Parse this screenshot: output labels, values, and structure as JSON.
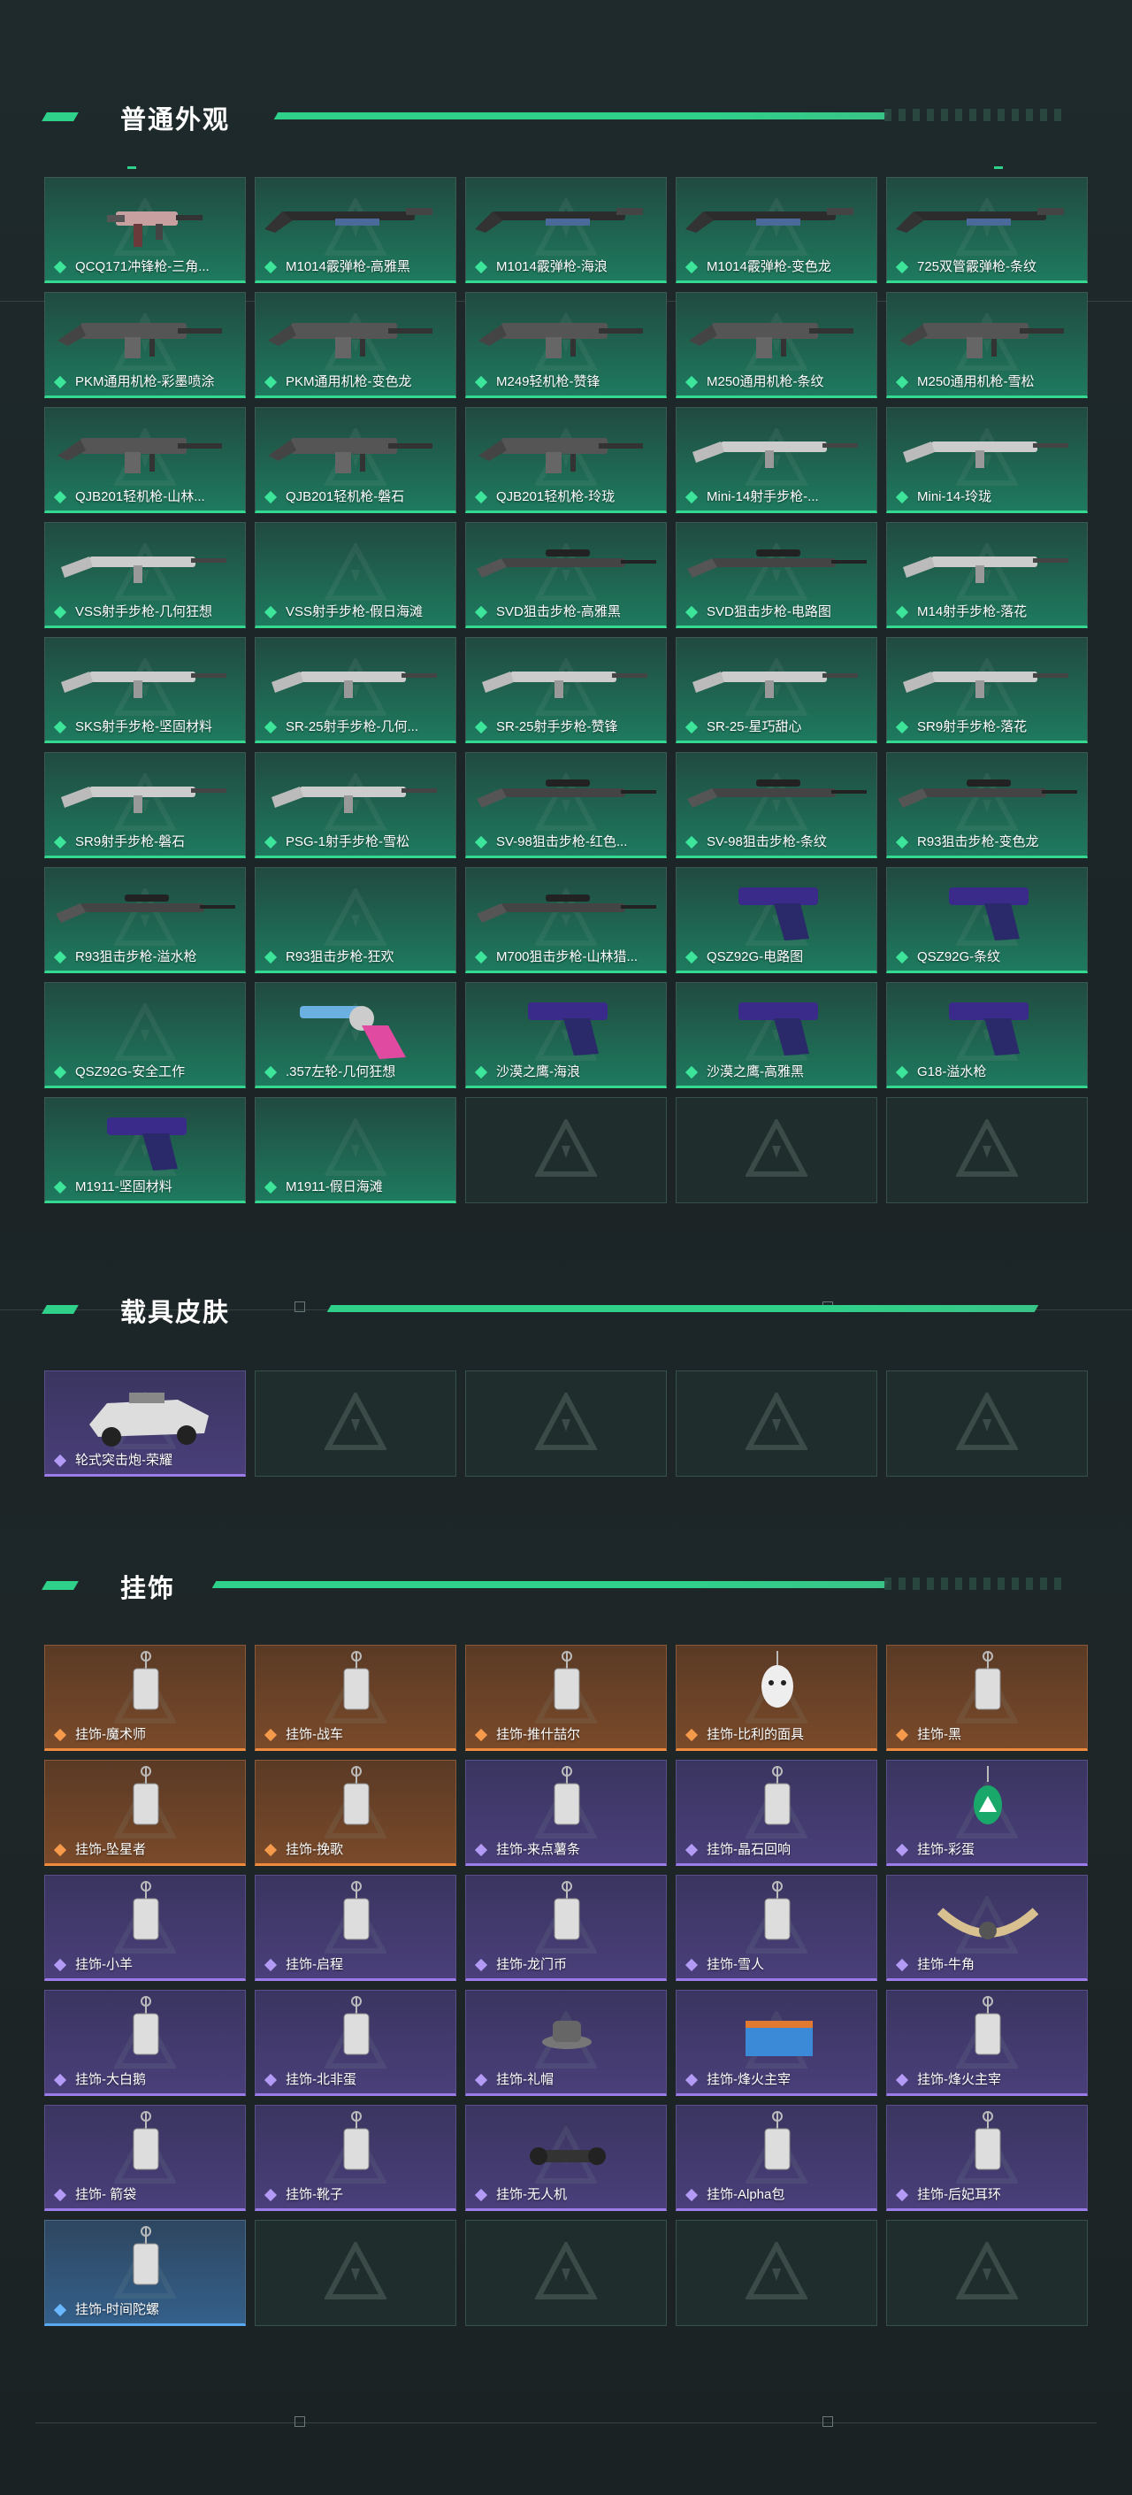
{
  "sections": {
    "weapons": {
      "title": "普通外观",
      "items": [
        {
          "label": "QCQ171冲锋枪-三角...",
          "rarity": "green",
          "icon": "smg-icon"
        },
        {
          "label": "M1014霰弹枪-高雅黑",
          "rarity": "green",
          "icon": "shotgun-icon"
        },
        {
          "label": "M1014霰弹枪-海浪",
          "rarity": "green",
          "icon": "shotgun-icon"
        },
        {
          "label": "M1014霰弹枪-变色龙",
          "rarity": "green",
          "icon": "shotgun-icon"
        },
        {
          "label": "725双管霰弹枪-条纹",
          "rarity": "green",
          "icon": "shotgun-icon"
        },
        {
          "label": "PKM通用机枪-彩墨喷涂",
          "rarity": "green",
          "icon": "machinegun-icon"
        },
        {
          "label": "PKM通用机枪-变色龙",
          "rarity": "green",
          "icon": "machinegun-icon"
        },
        {
          "label": "M249轻机枪-赞锋",
          "rarity": "green",
          "icon": "machinegun-icon"
        },
        {
          "label": "M250通用机枪-条纹",
          "rarity": "green",
          "icon": "machinegun-icon"
        },
        {
          "label": "M250通用机枪-雪松",
          "rarity": "green",
          "icon": "machinegun-icon"
        },
        {
          "label": "QJB201轻机枪-山林...",
          "rarity": "green",
          "icon": "machinegun-icon"
        },
        {
          "label": "QJB201轻机枪-磐石",
          "rarity": "green",
          "icon": "machinegun-icon"
        },
        {
          "label": "QJB201轻机枪-玲珑",
          "rarity": "green",
          "icon": "machinegun-icon"
        },
        {
          "label": "Mini-14射手步枪-...",
          "rarity": "green",
          "icon": "rifle-icon"
        },
        {
          "label": "Mini-14-玲珑",
          "rarity": "green",
          "icon": "rifle-icon"
        },
        {
          "label": "VSS射手步枪-几何狂想",
          "rarity": "green",
          "icon": "rifle-icon"
        },
        {
          "label": "VSS射手步枪-假日海滩",
          "rarity": "green",
          "icon": ""
        },
        {
          "label": "SVD狙击步枪-高雅黑",
          "rarity": "green",
          "icon": "sniper-icon"
        },
        {
          "label": "SVD狙击步枪-电路图",
          "rarity": "green",
          "icon": "sniper-icon"
        },
        {
          "label": "M14射手步枪-落花",
          "rarity": "green",
          "icon": "rifle-icon"
        },
        {
          "label": "SKS射手步枪-坚固材料",
          "rarity": "green",
          "icon": "rifle-icon"
        },
        {
          "label": "SR-25射手步枪-几何...",
          "rarity": "green",
          "icon": "rifle-icon"
        },
        {
          "label": "SR-25射手步枪-赞锋",
          "rarity": "green",
          "icon": "rifle-icon"
        },
        {
          "label": "SR-25-星巧甜心",
          "rarity": "green",
          "icon": "rifle-icon"
        },
        {
          "label": "SR9射手步枪-落花",
          "rarity": "green",
          "icon": "rifle-icon"
        },
        {
          "label": "SR9射手步枪-磐石",
          "rarity": "green",
          "icon": "rifle-icon"
        },
        {
          "label": "PSG-1射手步枪-雪松",
          "rarity": "green",
          "icon": "rifle-icon"
        },
        {
          "label": "SV-98狙击步枪-红色...",
          "rarity": "green",
          "icon": "sniper-icon"
        },
        {
          "label": "SV-98狙击步枪-条纹",
          "rarity": "green",
          "icon": "sniper-icon"
        },
        {
          "label": "R93狙击步枪-变色龙",
          "rarity": "green",
          "icon": "sniper-icon"
        },
        {
          "label": "R93狙击步枪-溢水枪",
          "rarity": "green",
          "icon": "sniper-icon"
        },
        {
          "label": "R93狙击步枪-狂欢",
          "rarity": "green",
          "icon": ""
        },
        {
          "label": "M700狙击步枪-山林猎...",
          "rarity": "green",
          "icon": "sniper-icon"
        },
        {
          "label": "QSZ92G-电路图",
          "rarity": "green",
          "icon": "pistol-icon"
        },
        {
          "label": "QSZ92G-条纹",
          "rarity": "green",
          "icon": "pistol-icon"
        },
        {
          "label": "QSZ92G-安全工作",
          "rarity": "green",
          "icon": ""
        },
        {
          "label": ".357左轮-几何狂想",
          "rarity": "green",
          "icon": "revolver-icon"
        },
        {
          "label": "沙漠之鹰-海浪",
          "rarity": "green",
          "icon": "pistol-icon"
        },
        {
          "label": "沙漠之鹰-高雅黑",
          "rarity": "green",
          "icon": "pistol-icon"
        },
        {
          "label": "G18-溢水枪",
          "rarity": "green",
          "icon": "pistol-icon"
        },
        {
          "label": "M1911-坚固材料",
          "rarity": "green",
          "icon": "pistol-icon"
        },
        {
          "label": "M1911-假日海滩",
          "rarity": "green",
          "icon": ""
        },
        {
          "label": "",
          "rarity": "empty",
          "icon": ""
        },
        {
          "label": "",
          "rarity": "empty",
          "icon": ""
        },
        {
          "label": "",
          "rarity": "empty",
          "icon": ""
        }
      ]
    },
    "vehicles": {
      "title": "载具皮肤",
      "items": [
        {
          "label": "轮式突击炮-荣耀",
          "rarity": "purple",
          "icon": "vehicle-icon"
        },
        {
          "label": "",
          "rarity": "empty",
          "icon": ""
        },
        {
          "label": "",
          "rarity": "empty",
          "icon": ""
        },
        {
          "label": "",
          "rarity": "empty",
          "icon": ""
        },
        {
          "label": "",
          "rarity": "empty",
          "icon": ""
        }
      ]
    },
    "charms": {
      "title": "挂饰",
      "items": [
        {
          "label": "挂饰-魔术师",
          "rarity": "orange",
          "icon": "charm-tag-icon"
        },
        {
          "label": "挂饰-战车",
          "rarity": "orange",
          "icon": "charm-card-icon"
        },
        {
          "label": "挂饰-推什喆尔",
          "rarity": "orange",
          "icon": "charm-tag-icon"
        },
        {
          "label": "挂饰-比利的面具",
          "rarity": "orange",
          "icon": "charm-mask-icon"
        },
        {
          "label": "挂饰-黑",
          "rarity": "orange",
          "icon": "charm-tag-icon"
        },
        {
          "label": "挂饰-坠星者",
          "rarity": "orange",
          "icon": "charm-crystal-icon"
        },
        {
          "label": "挂饰-挽歌",
          "rarity": "orange",
          "icon": "charm-leaf-icon"
        },
        {
          "label": "挂饰-来点薯条",
          "rarity": "purple",
          "icon": "charm-fries-icon"
        },
        {
          "label": "挂饰-晶石回响",
          "rarity": "purple",
          "icon": "charm-gem-icon"
        },
        {
          "label": "挂饰-彩蛋",
          "rarity": "purple",
          "icon": "charm-egg-icon"
        },
        {
          "label": "挂饰-小羊",
          "rarity": "purple",
          "icon": "charm-sheep-icon"
        },
        {
          "label": "挂饰-启程",
          "rarity": "purple",
          "icon": "charm-medal-icon"
        },
        {
          "label": "挂饰-龙门币",
          "rarity": "purple",
          "icon": "charm-coin-icon"
        },
        {
          "label": "挂饰-雪人",
          "rarity": "purple",
          "icon": "charm-snowman-icon"
        },
        {
          "label": "挂饰-牛角",
          "rarity": "purple",
          "icon": "charm-horn-icon"
        },
        {
          "label": "挂饰-大白鹅",
          "rarity": "purple",
          "icon": "charm-goose-icon"
        },
        {
          "label": "挂饰-北非蛋",
          "rarity": "purple",
          "icon": "charm-pan-icon"
        },
        {
          "label": "挂饰-礼帽",
          "rarity": "purple",
          "icon": "charm-hat-icon"
        },
        {
          "label": "挂饰-烽火主宰",
          "rarity": "purple",
          "icon": "charm-container-icon"
        },
        {
          "label": "挂饰-烽火主宰",
          "rarity": "purple",
          "icon": "charm-triangle-icon"
        },
        {
          "label": "挂饰- 箭袋",
          "rarity": "purple",
          "icon": "charm-quiver-icon"
        },
        {
          "label": "挂饰-靴子",
          "rarity": "purple",
          "icon": "charm-boot-icon"
        },
        {
          "label": "挂饰-无人机",
          "rarity": "purple",
          "icon": "charm-drone-icon"
        },
        {
          "label": "挂饰-Alpha包",
          "rarity": "purple",
          "icon": "charm-bag-icon"
        },
        {
          "label": "挂饰-后妃耳环",
          "rarity": "purple",
          "icon": "charm-earring-icon"
        },
        {
          "label": "挂饰-时间陀螺",
          "rarity": "blue",
          "icon": "charm-top-icon"
        },
        {
          "label": "",
          "rarity": "empty",
          "icon": ""
        },
        {
          "label": "",
          "rarity": "empty",
          "icon": ""
        },
        {
          "label": "",
          "rarity": "empty",
          "icon": ""
        },
        {
          "label": "",
          "rarity": "empty",
          "icon": ""
        }
      ]
    }
  },
  "colors": {
    "accent": "#2fd08a",
    "green_card": "#1e7a5e",
    "purple_card": "#4a3f7a",
    "orange_card": "#7a4a2a",
    "blue_card": "#34608a"
  }
}
